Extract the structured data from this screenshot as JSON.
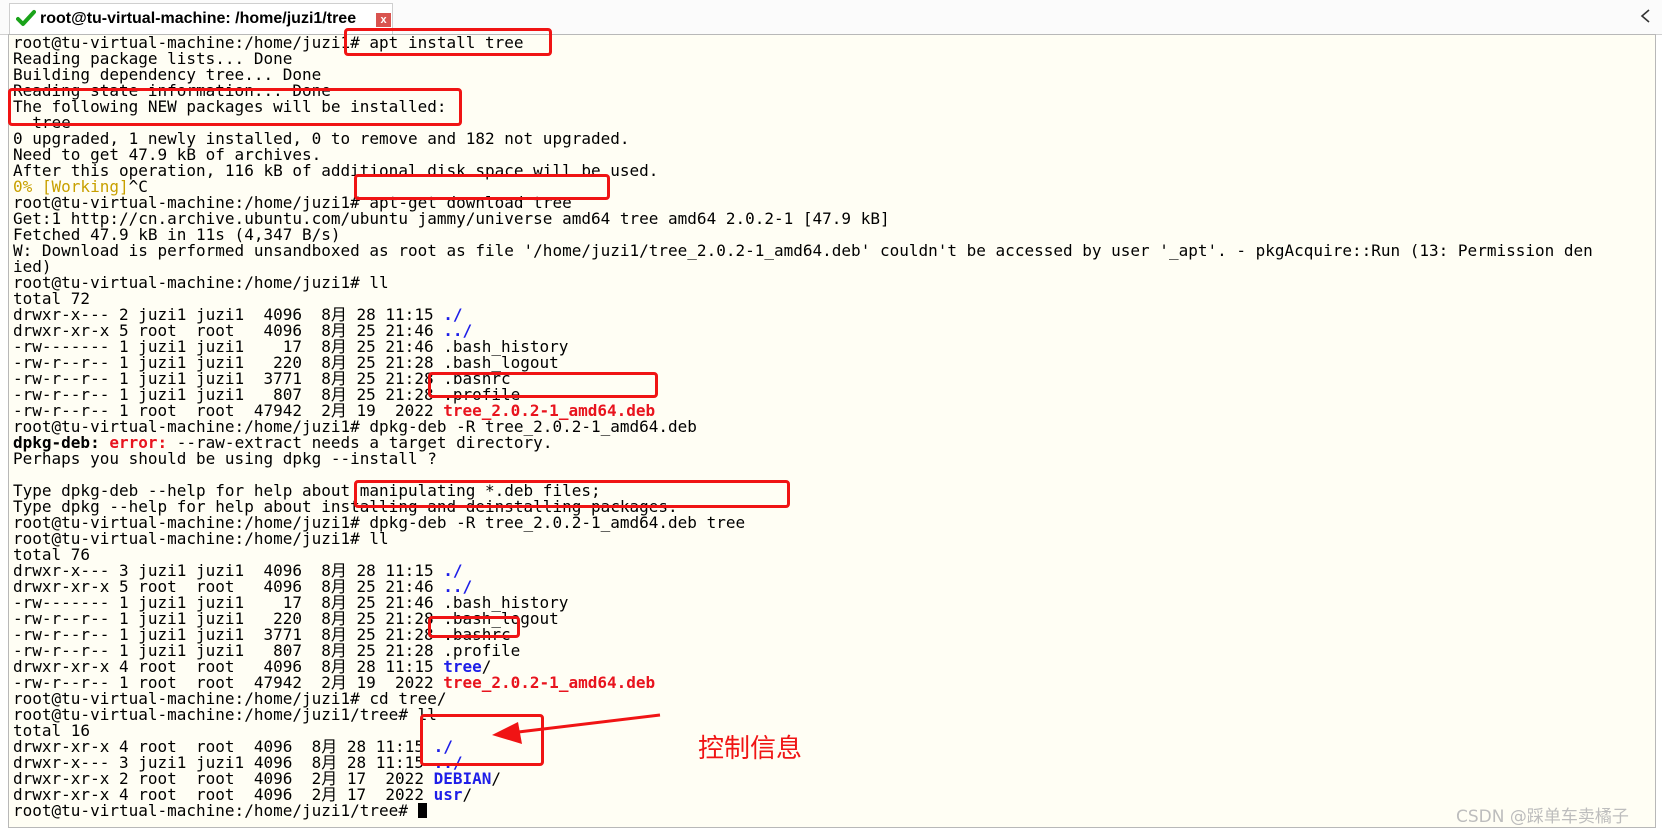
{
  "window": {
    "tab_title": "root@tu-virtual-machine: /home/juzi1/tree",
    "tab_status_icon": "check-icon",
    "tab_close_label": "x",
    "scroll_icon": "chevron-left-icon"
  },
  "colors": {
    "terminal_bg": "#fffef4",
    "highlight": "#f01414",
    "ls_dir": "#1e1ee8",
    "ls_deb": "#e8141e",
    "progress": "#c8a000"
  },
  "terminal": {
    "lines": [
      [
        {
          "t": "root@tu-virtual-machine:/home/juzi1# apt install tree"
        }
      ],
      [
        {
          "t": "Reading package lists... Done"
        }
      ],
      [
        {
          "t": "Building dependency tree... Done"
        }
      ],
      [
        {
          "t": "Reading state information... Done"
        }
      ],
      [
        {
          "t": "The following NEW packages will be installed:"
        }
      ],
      [
        {
          "t": "  tree"
        }
      ],
      [
        {
          "t": "0 upgraded, 1 newly installed, 0 to remove and 182 not upgraded."
        }
      ],
      [
        {
          "t": "Need to get 47.9 kB of archives."
        }
      ],
      [
        {
          "t": "After this operation, 116 kB of additional disk space will be used."
        }
      ],
      [
        {
          "t": "0% [Working]",
          "c": "ylw"
        },
        {
          "t": "^C"
        }
      ],
      [
        {
          "t": "root@tu-virtual-machine:/home/juzi1# apt-get download tree"
        }
      ],
      [
        {
          "t": "Get:1 http://cn.archive.ubuntu.com/ubuntu jammy/universe amd64 tree amd64 2.0.2-1 [47.9 kB]"
        }
      ],
      [
        {
          "t": "Fetched 47.9 kB in 11s (4,347 B/s)"
        }
      ],
      [
        {
          "t": "W: Download is performed unsandboxed as root as file '/home/juzi1/tree_2.0.2-1_amd64.deb' couldn't be accessed by user '_apt'. - pkgAcquire::Run (13: Permission den"
        }
      ],
      [
        {
          "t": "ied)"
        }
      ],
      [
        {
          "t": "root@tu-virtual-machine:/home/juzi1# ll"
        }
      ],
      [
        {
          "t": "total 72"
        }
      ],
      [
        {
          "t": "drwxr-x--- 2 juzi1 juzi1  4096  8月 28 11:15 "
        },
        {
          "t": "./",
          "c": "blue"
        }
      ],
      [
        {
          "t": "drwxr-xr-x 5 root  root   4096  8月 25 21:46 "
        },
        {
          "t": "../",
          "c": "blue"
        }
      ],
      [
        {
          "t": "-rw------- 1 juzi1 juzi1    17  8月 25 21:46 .bash_history"
        }
      ],
      [
        {
          "t": "-rw-r--r-- 1 juzi1 juzi1   220  8月 25 21:28 .bash_logout"
        }
      ],
      [
        {
          "t": "-rw-r--r-- 1 juzi1 juzi1  3771  8月 25 21:28 .bashrc"
        }
      ],
      [
        {
          "t": "-rw-r--r-- 1 juzi1 juzi1   807  8月 25 21:28 .profile"
        }
      ],
      [
        {
          "t": "-rw-r--r-- 1 root  root  47942  2月 19  2022 "
        },
        {
          "t": "tree_2.0.2-1_amd64.deb",
          "c": "red"
        }
      ],
      [
        {
          "t": "root@tu-virtual-machine:/home/juzi1# dpkg-deb -R tree_2.0.2-1_amd64.deb"
        }
      ],
      [
        {
          "t": "dpkg-deb: ",
          "c": "bold"
        },
        {
          "t": "error: ",
          "c": "red"
        },
        {
          "t": "--raw-extract needs a target directory."
        }
      ],
      [
        {
          "t": "Perhaps you should be using dpkg --install ?"
        }
      ],
      [
        {
          "t": ""
        }
      ],
      [
        {
          "t": "Type dpkg-deb --help for help about manipulating *.deb files;"
        }
      ],
      [
        {
          "t": "Type dpkg --help for help about installing and deinstalling packages."
        }
      ],
      [
        {
          "t": "root@tu-virtual-machine:/home/juzi1# dpkg-deb -R tree_2.0.2-1_amd64.deb tree"
        }
      ],
      [
        {
          "t": "root@tu-virtual-machine:/home/juzi1# ll"
        }
      ],
      [
        {
          "t": "total 76"
        }
      ],
      [
        {
          "t": "drwxr-x--- 3 juzi1 juzi1  4096  8月 28 11:15 "
        },
        {
          "t": "./",
          "c": "blue"
        }
      ],
      [
        {
          "t": "drwxr-xr-x 5 root  root   4096  8月 25 21:46 "
        },
        {
          "t": "../",
          "c": "blue"
        }
      ],
      [
        {
          "t": "-rw------- 1 juzi1 juzi1    17  8月 25 21:46 .bash_history"
        }
      ],
      [
        {
          "t": "-rw-r--r-- 1 juzi1 juzi1   220  8月 25 21:28 .bash_logout"
        }
      ],
      [
        {
          "t": "-rw-r--r-- 1 juzi1 juzi1  3771  8月 25 21:28 .bashrc"
        }
      ],
      [
        {
          "t": "-rw-r--r-- 1 juzi1 juzi1   807  8月 25 21:28 .profile"
        }
      ],
      [
        {
          "t": "drwxr-xr-x 4 root  root   4096  8月 28 11:15 "
        },
        {
          "t": "tree",
          "c": "blue"
        },
        {
          "t": "/"
        }
      ],
      [
        {
          "t": "-rw-r--r-- 1 root  root  47942  2月 19  2022 "
        },
        {
          "t": "tree_2.0.2-1_amd64.deb",
          "c": "red"
        }
      ],
      [
        {
          "t": "root@tu-virtual-machine:/home/juzi1# cd tree/"
        }
      ],
      [
        {
          "t": "root@tu-virtual-machine:/home/juzi1/tree# ll"
        }
      ],
      [
        {
          "t": "total 16"
        }
      ],
      [
        {
          "t": "drwxr-xr-x 4 root  root  4096  8月 28 11:15 "
        },
        {
          "t": "./",
          "c": "blue"
        }
      ],
      [
        {
          "t": "drwxr-x--- 3 juzi1 juzi1 4096  8月 28 11:15 "
        },
        {
          "t": "../",
          "c": "blue"
        }
      ],
      [
        {
          "t": "drwxr-xr-x 2 root  root  4096  2月 17  2022 "
        },
        {
          "t": "DEBIAN",
          "c": "blue"
        },
        {
          "t": "/"
        }
      ],
      [
        {
          "t": "drwxr-xr-x 4 root  root  4096  2月 17  2022 "
        },
        {
          "t": "usr",
          "c": "blue"
        },
        {
          "t": "/"
        }
      ],
      [
        {
          "t": "root@tu-virtual-machine:/home/juzi1/tree# "
        },
        {
          "t": "",
          "c": "cursor"
        }
      ]
    ]
  },
  "annotation": {
    "label": "控制信息"
  },
  "watermark": "CSDN @踩单车卖橘子"
}
